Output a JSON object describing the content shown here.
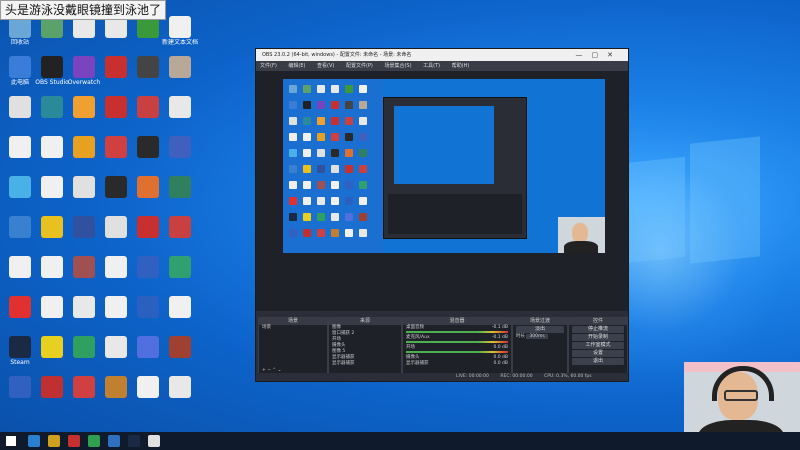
{
  "overlay_text": "头是游泳没戴眼镜撞到泳池了",
  "desktop_icons": [
    {
      "label": "回收站",
      "color": "#6aa7d6"
    },
    {
      "label": "",
      "color": "#5aa16a"
    },
    {
      "label": "",
      "color": "#e8e8e8"
    },
    {
      "label": "",
      "color": "#e8e8e8"
    },
    {
      "label": "",
      "color": "#3a9a3a"
    },
    {
      "label": "新建文本文档",
      "color": "#f0f0f0"
    },
    {
      "label": "此电脑",
      "color": "#3a7dd8"
    },
    {
      "label": "OBS Studio",
      "color": "#222222"
    },
    {
      "label": "Overwatch",
      "color": "#7a44c0"
    },
    {
      "label": "",
      "color": "#c83030"
    },
    {
      "label": "",
      "color": "#444444"
    },
    {
      "label": "",
      "color": "#b8a898"
    },
    {
      "label": "",
      "color": "#e0e0e0"
    },
    {
      "label": "",
      "color": "#2a8a9a"
    },
    {
      "label": "",
      "color": "#f0a030"
    },
    {
      "label": "",
      "color": "#c83030"
    },
    {
      "label": "",
      "color": "#c84040"
    },
    {
      "label": "",
      "color": "#e8e8e8"
    },
    {
      "label": "",
      "color": "#f0f0f0"
    },
    {
      "label": "",
      "color": "#f0f0f0"
    },
    {
      "label": "",
      "color": "#e8a020"
    },
    {
      "label": "",
      "color": "#d04040"
    },
    {
      "label": "",
      "color": "#2a2a2a"
    },
    {
      "label": "",
      "color": "#4060c0"
    },
    {
      "label": "",
      "color": "#4ab0e8"
    },
    {
      "label": "",
      "color": "#f0f0f0"
    },
    {
      "label": "",
      "color": "#e0e0e0"
    },
    {
      "label": "",
      "color": "#2a2a2a"
    },
    {
      "label": "",
      "color": "#e07030"
    },
    {
      "label": "",
      "color": "#308060"
    },
    {
      "label": "",
      "color": "#3a80d0"
    },
    {
      "label": "",
      "color": "#e8c020"
    },
    {
      "label": "",
      "color": "#3050a0"
    },
    {
      "label": "",
      "color": "#e0e0e0"
    },
    {
      "label": "",
      "color": "#c83030"
    },
    {
      "label": "",
      "color": "#c84040"
    },
    {
      "label": "",
      "color": "#f0f0f0"
    },
    {
      "label": "",
      "color": "#f0f0f0"
    },
    {
      "label": "",
      "color": "#a05050"
    },
    {
      "label": "",
      "color": "#f0f0f0"
    },
    {
      "label": "",
      "color": "#3060c0"
    },
    {
      "label": "",
      "color": "#30a070"
    },
    {
      "label": "",
      "color": "#e03030"
    },
    {
      "label": "",
      "color": "#f0f0f0"
    },
    {
      "label": "",
      "color": "#e8e8e8"
    },
    {
      "label": "",
      "color": "#f0f0f0"
    },
    {
      "label": "",
      "color": "#2a60c0"
    },
    {
      "label": "",
      "color": "#f0f0f0"
    },
    {
      "label": "Steam",
      "color": "#1b2a44"
    },
    {
      "label": "",
      "color": "#e8d020"
    },
    {
      "label": "",
      "color": "#30a060"
    },
    {
      "label": "",
      "color": "#e8e8e8"
    },
    {
      "label": "",
      "color": "#5070e0"
    },
    {
      "label": "",
      "color": "#a04030"
    },
    {
      "label": "",
      "color": "#3060c0"
    },
    {
      "label": "",
      "color": "#c03030"
    },
    {
      "label": "",
      "color": "#d04040"
    },
    {
      "label": "",
      "color": "#c08030"
    },
    {
      "label": "",
      "color": "#f0f0f0"
    },
    {
      "label": "",
      "color": "#e8e8e8"
    }
  ],
  "obs": {
    "title": "OBS 23.0.2 (64-bit, windows) - 配置文件: 未命名 - 场景: 未命名",
    "menu": [
      "文件(F)",
      "编辑(E)",
      "查看(V)",
      "配置文件(P)",
      "场景集合(S)",
      "工具(T)",
      "帮助(H)"
    ],
    "docks": {
      "scenes": {
        "title": "场景",
        "items": [
          "场景"
        ]
      },
      "sources": {
        "title": "来源",
        "items": [
          "图像",
          "窗口捕获 2",
          "开场",
          "摄像头",
          "图像 5",
          "显示器捕获",
          "显示器捕获"
        ]
      },
      "mixer": {
        "title": "混音器",
        "channels": [
          {
            "name": "桌面音频",
            "db": "-0.1 dB"
          },
          {
            "name": "麦克风/Aux",
            "db": "-0.1 dB"
          },
          {
            "name": "开场",
            "db": "0.0 dB"
          },
          {
            "name": "摄像头",
            "db": "0.0 dB"
          },
          {
            "name": "显示器捕获",
            "db": "0.0 dB"
          }
        ]
      },
      "transitions": {
        "title": "场景过渡",
        "type": "淡出",
        "duration_label": "时长",
        "duration": "300ms"
      },
      "controls": {
        "title": "控件",
        "buttons": [
          "停止推流",
          "开始录制",
          "工作室模式",
          "设置",
          "退出"
        ]
      }
    },
    "status": {
      "live": "LIVE: 00:00:00",
      "rec": "REC: 00:00:00",
      "cpu": "CPU: 0.3%, 60.00 fps"
    }
  },
  "taskbar": {
    "icons": [
      "#2a80d0",
      "#d0a020",
      "#c83030",
      "#30a050",
      "#3070c0",
      "#1b2a44",
      "#e0e0e0"
    ]
  }
}
